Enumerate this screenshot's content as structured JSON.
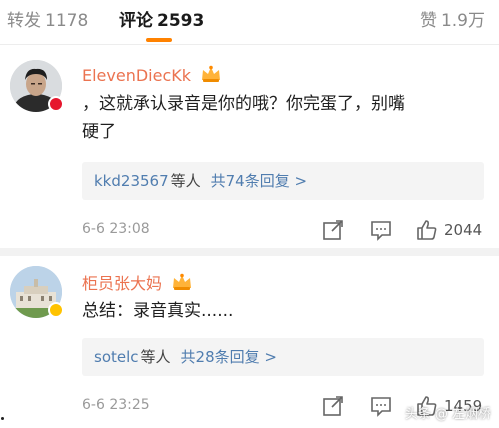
{
  "tabs": {
    "repost": {
      "label": "转发",
      "count": "1178"
    },
    "comment": {
      "label": "评论",
      "count": "2593"
    },
    "like": {
      "label": "赞",
      "count": "1.9万"
    }
  },
  "colors": {
    "accent": "#ff8200",
    "username": "#eb7350",
    "link": "#507daf"
  },
  "comments": [
    {
      "username": "ElevenDiecKk",
      "text_line1": "，这就承认录音是你的哦？你完蛋了，别嘴",
      "text_line2": "硬了",
      "replies": {
        "users": "kkd23567",
        "suffix": "等人",
        "count": "共74条回复 >"
      },
      "timestamp": "6-6 23:08",
      "likes": "2044"
    },
    {
      "username": "柜员张大妈",
      "text_line1": "总结：录音真实......",
      "replies": {
        "users": "sotelc",
        "suffix": "等人",
        "count": "共28条回复 >"
      },
      "timestamp": "6-6 23:25",
      "likes": "1459"
    }
  ],
  "watermark": "头条 @ 左烟桥"
}
